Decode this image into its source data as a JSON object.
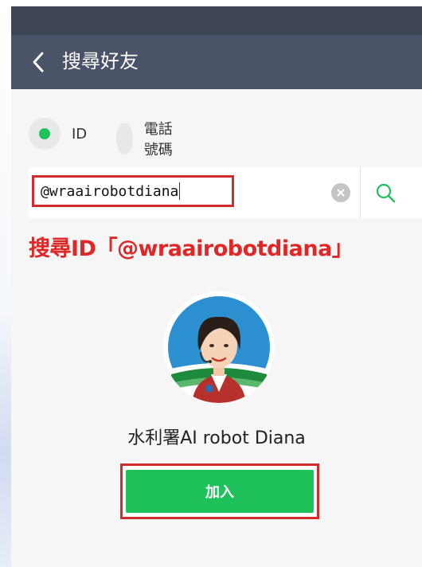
{
  "header": {
    "title": "搜尋好友"
  },
  "search_type": {
    "options": [
      {
        "label": "ID",
        "selected": true
      },
      {
        "label": "電話號碼",
        "selected": false
      }
    ]
  },
  "search": {
    "value": "@wraairobotdiana"
  },
  "caption": "搜尋ID「@wraairobotdiana」",
  "result": {
    "display_name": "水利署AI robot Diana"
  },
  "actions": {
    "add_label": "加入"
  },
  "icons": {
    "back": "chevron-left-icon",
    "clear": "clear-circle-icon",
    "search": "search-icon",
    "avatar": "robot-avatar-image"
  },
  "colors": {
    "accent_green": "#1fc25a",
    "header_bg": "#4a5368",
    "highlight_red": "#d42a2a",
    "caption_red": "#e02727"
  }
}
